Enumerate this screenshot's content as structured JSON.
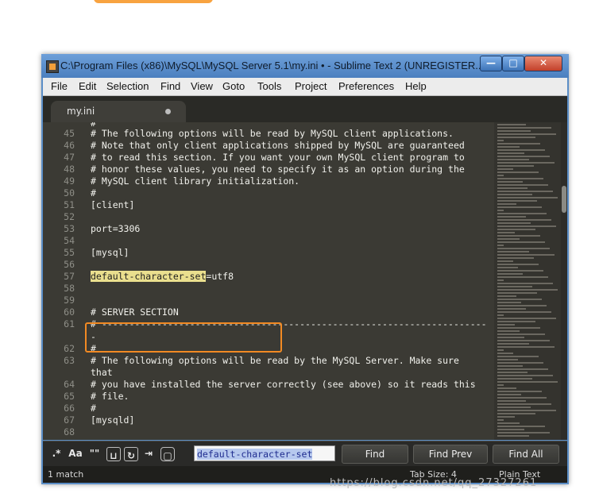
{
  "window": {
    "title": "C:\\Program Files (x86)\\MySQL\\MySQL Server 5.1\\my.ini • - Sublime Text 2 (UNREGISTER...",
    "controls": [
      "—",
      "□",
      "✕"
    ]
  },
  "menu": [
    "File",
    "Edit",
    "Selection",
    "Find",
    "View",
    "Goto",
    "Tools",
    "Project",
    "Preferences",
    "Help"
  ],
  "tab": {
    "label": "my.ini",
    "modified": true
  },
  "editor": {
    "lines": [
      {
        "n": "",
        "text": "#"
      },
      {
        "n": "45",
        "text": "# The following options will be read by MySQL client applications."
      },
      {
        "n": "46",
        "text": "# Note that only client applications shipped by MySQL are guaranteed"
      },
      {
        "n": "47",
        "text": "# to read this section. If you want your own MySQL client program to"
      },
      {
        "n": "48",
        "text": "# honor these values, you need to specify it as an option during the"
      },
      {
        "n": "49",
        "text": "# MySQL client library initialization."
      },
      {
        "n": "50",
        "text": "#"
      },
      {
        "n": "51",
        "text": "[client]"
      },
      {
        "n": "52",
        "text": ""
      },
      {
        "n": "53",
        "text": "port=3306"
      },
      {
        "n": "54",
        "text": ""
      },
      {
        "n": "55",
        "text": "[mysql]"
      },
      {
        "n": "56",
        "text": ""
      },
      {
        "n": "57",
        "text": "default-character-set",
        "highlight": true,
        "rest": "=utf8"
      },
      {
        "n": "58",
        "text": ""
      },
      {
        "n": "59",
        "text": ""
      },
      {
        "n": "60",
        "text": "# SERVER SECTION"
      },
      {
        "n": "61",
        "text": "# ----------------------------------------------------------------------"
      },
      {
        "n": "",
        "text": "-"
      },
      {
        "n": "62",
        "text": "#"
      },
      {
        "n": "63",
        "text": "# The following options will be read by the MySQL Server. Make sure"
      },
      {
        "n": "",
        "text": "that"
      },
      {
        "n": "64",
        "text": "# you have installed the server correctly (see above) so it reads this"
      },
      {
        "n": "65",
        "text": "# file."
      },
      {
        "n": "66",
        "text": "#"
      },
      {
        "n": "67",
        "text": "[mysqld]"
      },
      {
        "n": "68",
        "text": ""
      }
    ]
  },
  "find": {
    "options": [
      ".*",
      "Aa",
      "\"\"",
      "⊔",
      "↻",
      "⇥",
      "▢"
    ],
    "query": "default-character-set",
    "buttons": {
      "find": "Find",
      "find_prev": "Find Prev",
      "find_all": "Find All"
    }
  },
  "status": {
    "matches": "1 match",
    "tab_size": "Tab Size: 4",
    "syntax": "Plain Text"
  },
  "watermark": "https://blog.csdn.net/qq_27327261",
  "colors": {
    "editor_bg": "#3b3a34",
    "match_highlight": "#eadf8e",
    "annotation_box": "#f28a23",
    "title_bar": "#5b8ec7"
  }
}
